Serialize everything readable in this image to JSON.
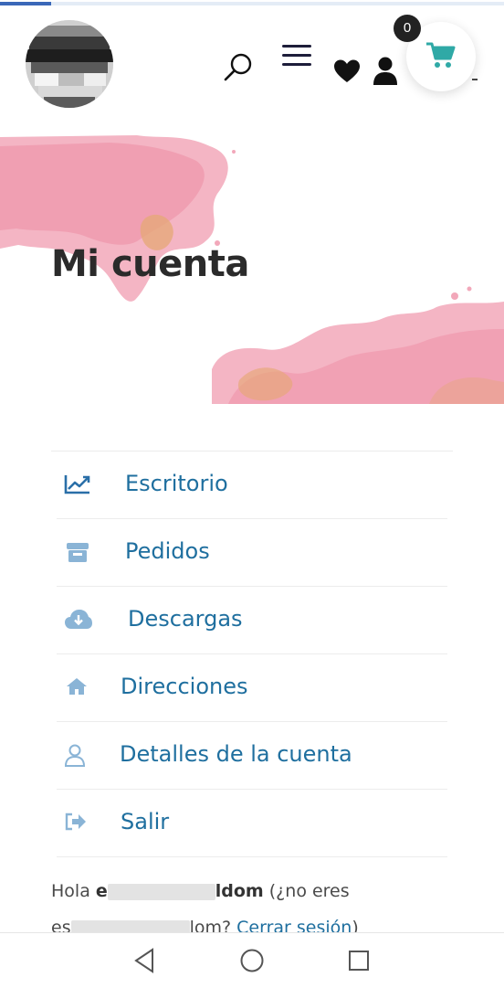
{
  "header": {
    "cart_count": "0",
    "icons": [
      "search-icon",
      "hamburger-menu-icon",
      "heart-icon",
      "user-icon",
      "cart-icon"
    ]
  },
  "hero": {
    "title": "Mi cuenta"
  },
  "account_nav": {
    "items": [
      {
        "label": "Escritorio",
        "icon": "chart-line-icon"
      },
      {
        "label": "Pedidos",
        "icon": "store-icon"
      },
      {
        "label": "Descargas",
        "icon": "cloud-download-icon"
      },
      {
        "label": "Direcciones",
        "icon": "home-icon"
      },
      {
        "label": "Detalles de la cuenta",
        "icon": "user-outline-icon"
      },
      {
        "label": "Salir",
        "icon": "sign-out-icon"
      }
    ]
  },
  "greeting": {
    "hello": "Hola ",
    "user_start": "e",
    "user_end": "ldom",
    "not_you_open": " (¿no eres ",
    "user2_start": "es",
    "user2_end": "lom",
    "question": "? ",
    "logout_link": "Cerrar sesión",
    "close": ")"
  },
  "colors": {
    "link": "#1f6f9f",
    "icon": "#8ab4d6",
    "cart_accent": "#2fa9a6",
    "title": "#2b2b2b",
    "watercolor": "#f0a1b6"
  },
  "system_nav": [
    "back-icon",
    "home-circle-icon",
    "recents-icon"
  ]
}
